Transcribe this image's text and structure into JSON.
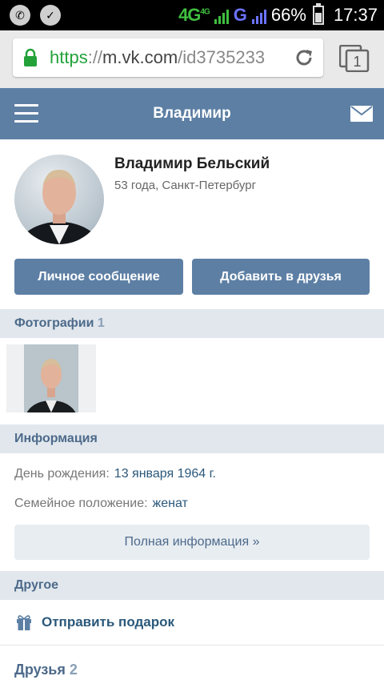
{
  "status_bar": {
    "network_left": "4G",
    "network_small": "4G",
    "network_g": "G",
    "battery": "66%",
    "time": "17:37"
  },
  "browser": {
    "url_scheme": "https",
    "url_sep": "://",
    "url_host": "m.vk.com",
    "url_path": "/id3735233",
    "tab_count": "1"
  },
  "header": {
    "title": "Владимир"
  },
  "profile": {
    "name": "Владимир Бельский",
    "subinfo": "53 года, Санкт-Петербург",
    "message_button": "Личное сообщение",
    "add_friend_button": "Добавить в друзья"
  },
  "photos": {
    "label": "Фотографии",
    "count": "1"
  },
  "info": {
    "label": "Информация",
    "birthday_label": "День рождения:",
    "birthday_value": "13 января 1964 г.",
    "family_label": "Семейное положение:",
    "family_value": "женат",
    "full_info_button": "Полная информация »"
  },
  "other": {
    "label": "Другое",
    "send_gift": "Отправить подарок"
  },
  "friends": {
    "label": "Друзья",
    "count": "2"
  },
  "colors": {
    "vk_blue": "#5d7fa4",
    "section_bg": "#e1e7ed",
    "link": "#2b587a",
    "secure_green": "#23a23a"
  }
}
